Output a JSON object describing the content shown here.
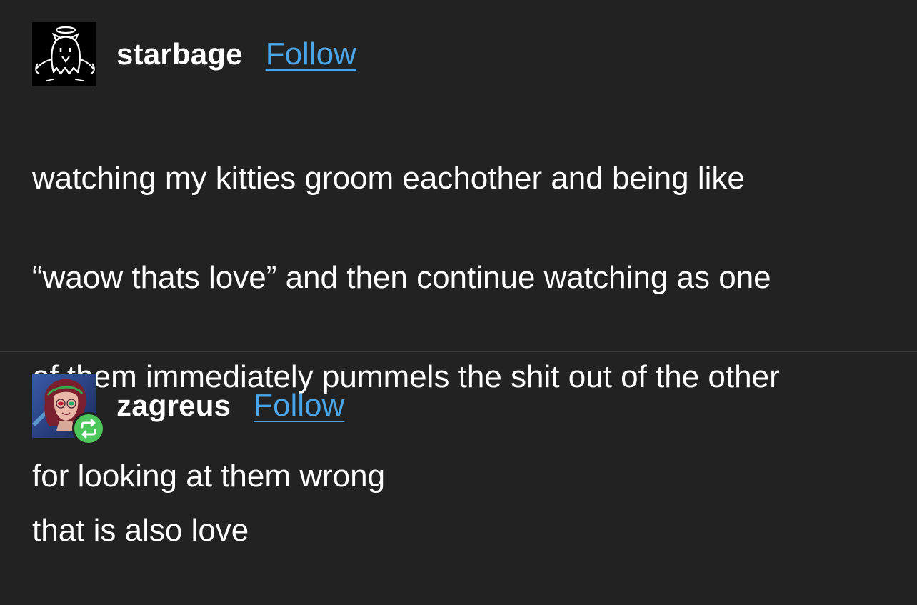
{
  "posts": [
    {
      "username": "starbage",
      "follow_label": "Follow",
      "avatar_icon": "ghost-angel-avatar-icon",
      "lines": [
        "watching my kitties groom eachother and being like",
        "“waow thats love” and then continue watching as one",
        "of them immediately pummels the shit out of the other",
        "for looking at them wrong"
      ]
    },
    {
      "username": "zagreus",
      "follow_label": "Follow",
      "avatar_icon": "character-portrait-avatar-icon",
      "reblog_icon": "reblog-icon",
      "lines": [
        "that is also love"
      ]
    }
  ],
  "colors": {
    "background": "#222222",
    "text": "#ffffff",
    "link": "#4aa6e8",
    "reblog_badge": "#4bc75c",
    "divider": "#3a3a3a"
  }
}
